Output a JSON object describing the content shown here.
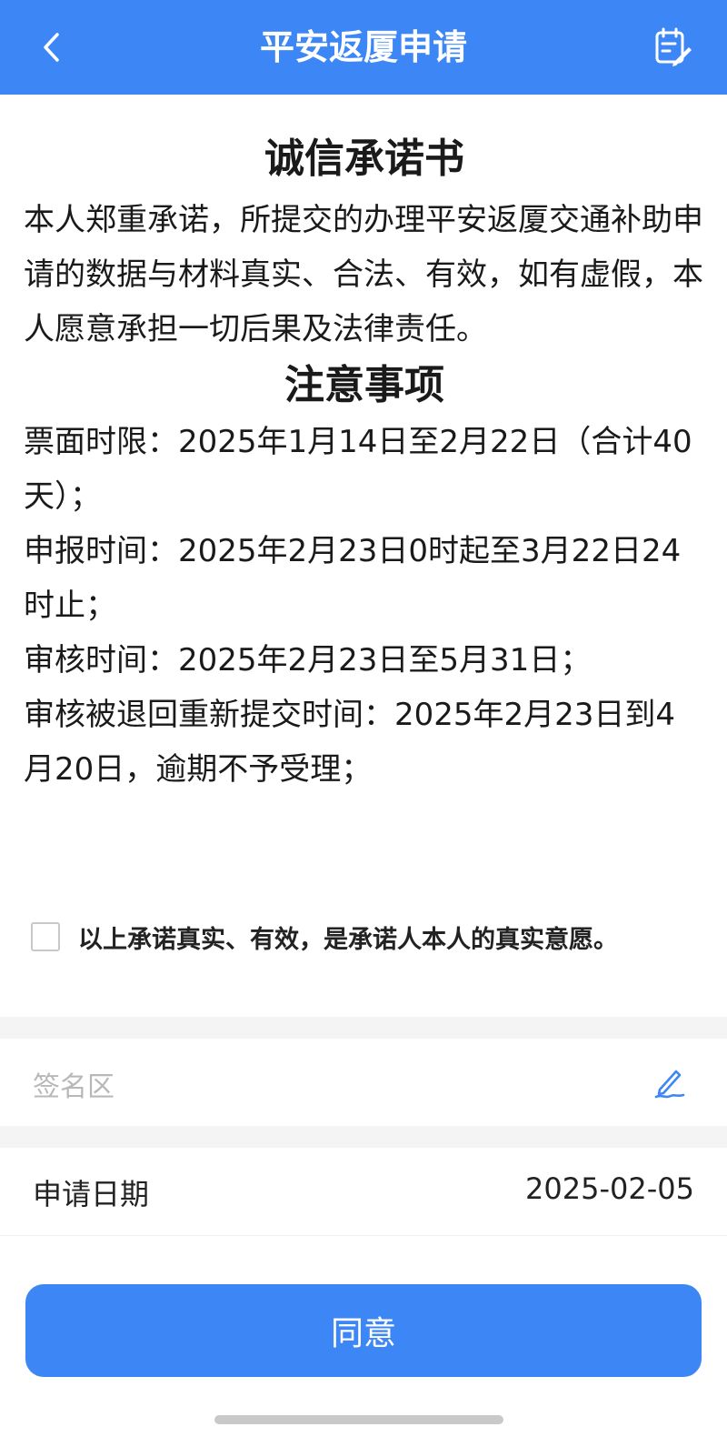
{
  "header": {
    "title": "平安返厦申请",
    "back_icon": "chevron-left-icon",
    "action_icon": "document-edit-icon"
  },
  "pledge": {
    "title": "诚信承诺书",
    "body": "本人郑重承诺，所提交的办理平安返厦交通补助申请的数据与材料真实、合法、有效，如有虚假，本人愿意承担一切后果及法律责任。"
  },
  "notice": {
    "title": "注意事项",
    "items": [
      "票面时限：2025年1月14日至2月22日（合计40天）；",
      "申报时间：2025年2月23日0时起至3月22日24时止；",
      "审核时间：2025年2月23日至5月31日；",
      "审核被退回重新提交时间：2025年2月23日到4月20日，逾期不予受理；"
    ]
  },
  "confirm": {
    "checked": false,
    "text": "以上承诺真实、有效，是承诺人本人的真实意愿。"
  },
  "signature": {
    "placeholder": "签名区",
    "icon": "pen-icon"
  },
  "apply_date": {
    "label": "申请日期",
    "value": "2025-02-05"
  },
  "agree_button": {
    "label": "同意"
  },
  "colors": {
    "primary": "#3d86f5",
    "background": "#ffffff",
    "section_gap": "#f4f4f4",
    "placeholder": "#b8b8b8"
  }
}
